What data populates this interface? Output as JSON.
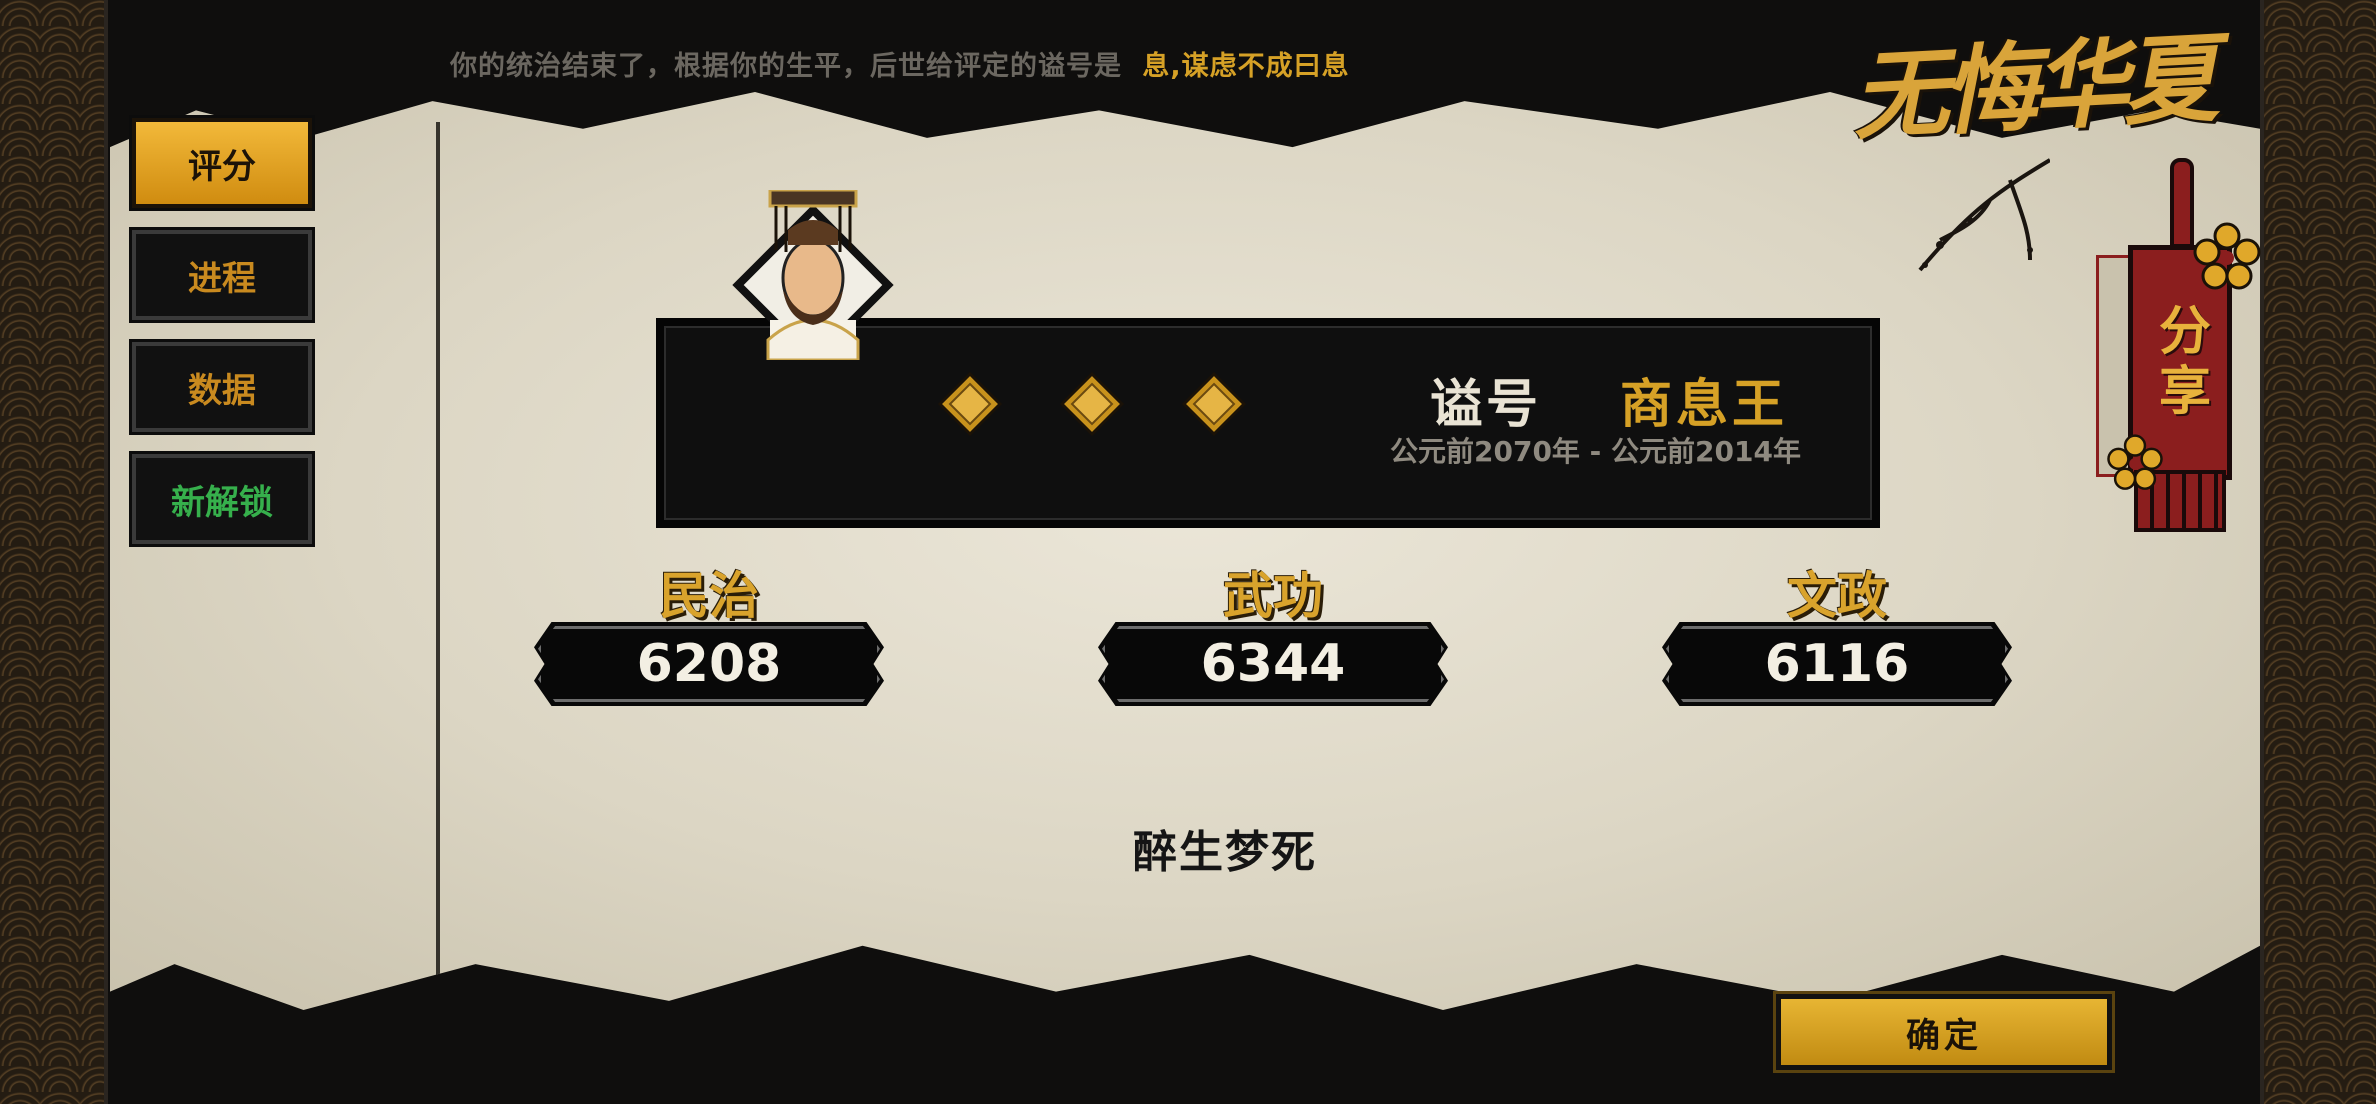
{
  "header": {
    "message": "你的统治结束了，根据你的生平，后世给评定的谥号是",
    "title_value": "息,谋虑不成曰息"
  },
  "logo": {
    "text": "无悔华夏"
  },
  "sidebar": {
    "items": [
      {
        "label": "评分",
        "active": true
      },
      {
        "label": "进程",
        "active": false
      },
      {
        "label": "数据",
        "active": false
      },
      {
        "label": "新解锁",
        "active": false
      }
    ]
  },
  "share": {
    "label": "分享"
  },
  "ruler": {
    "posthumous_label": "谥号",
    "posthumous_name": "商息王",
    "reign": "公元前2070年 - 公元前2014年",
    "rating_diamonds": 3
  },
  "stats": [
    {
      "label": "民治",
      "value": "6208"
    },
    {
      "label": "武功",
      "value": "6344"
    },
    {
      "label": "文政",
      "value": "6116"
    }
  ],
  "evaluation": {
    "idiom": "醉生梦死"
  },
  "footer": {
    "confirm_label": "确定"
  },
  "colors": {
    "gold": "#d6a126",
    "paper": "#dcd6c4",
    "dark": "#0f0f0f",
    "share_red": "#8b1e1e",
    "unlock_green": "#36b04c"
  }
}
